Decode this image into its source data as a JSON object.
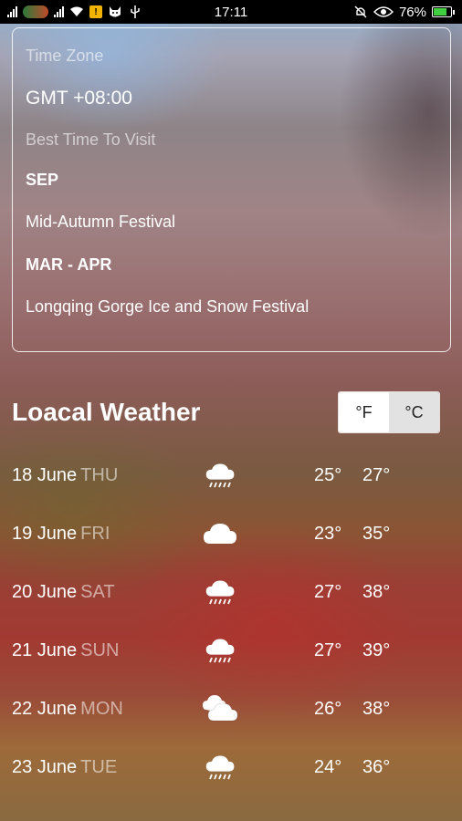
{
  "status_bar": {
    "time": "17:11",
    "battery": "76%",
    "battery_level": 0.76,
    "icons": [
      "signal-icon",
      "carrier-logo",
      "signal-icon",
      "wifi-icon",
      "notification-icon",
      "cat-icon",
      "usb-icon",
      "alarm-off-icon",
      "eye-icon",
      "battery-icon"
    ]
  },
  "info": {
    "time_zone_label": "Time Zone",
    "time_zone_value": "GMT +08:00",
    "best_time_label": "Best Time To Visit",
    "periods": [
      {
        "month": "SEP",
        "event": "Mid-Autumn Festival"
      },
      {
        "month": "MAR - APR",
        "event": "Longqing Gorge Ice and Snow Festival"
      }
    ]
  },
  "weather": {
    "title": "Loacal Weather",
    "unit_f": "°F",
    "unit_c": "°C",
    "selected_unit": "°C",
    "days": [
      {
        "date": "18 June",
        "dow": "THU",
        "icon": "rain-icon",
        "low": "25°",
        "high": "27°"
      },
      {
        "date": "19 June",
        "dow": "FRI",
        "icon": "cloud-icon",
        "low": "23°",
        "high": "35°"
      },
      {
        "date": "20 June",
        "dow": "SAT",
        "icon": "rain-icon",
        "low": "27°",
        "high": "38°"
      },
      {
        "date": "21 June",
        "dow": "SUN",
        "icon": "rain-icon",
        "low": "27°",
        "high": "39°"
      },
      {
        "date": "22 June",
        "dow": "MON",
        "icon": "partly-cloudy-icon",
        "low": "26°",
        "high": "38°"
      },
      {
        "date": "23 June",
        "dow": "TUE",
        "icon": "rain-icon",
        "low": "24°",
        "high": "36°"
      }
    ]
  }
}
